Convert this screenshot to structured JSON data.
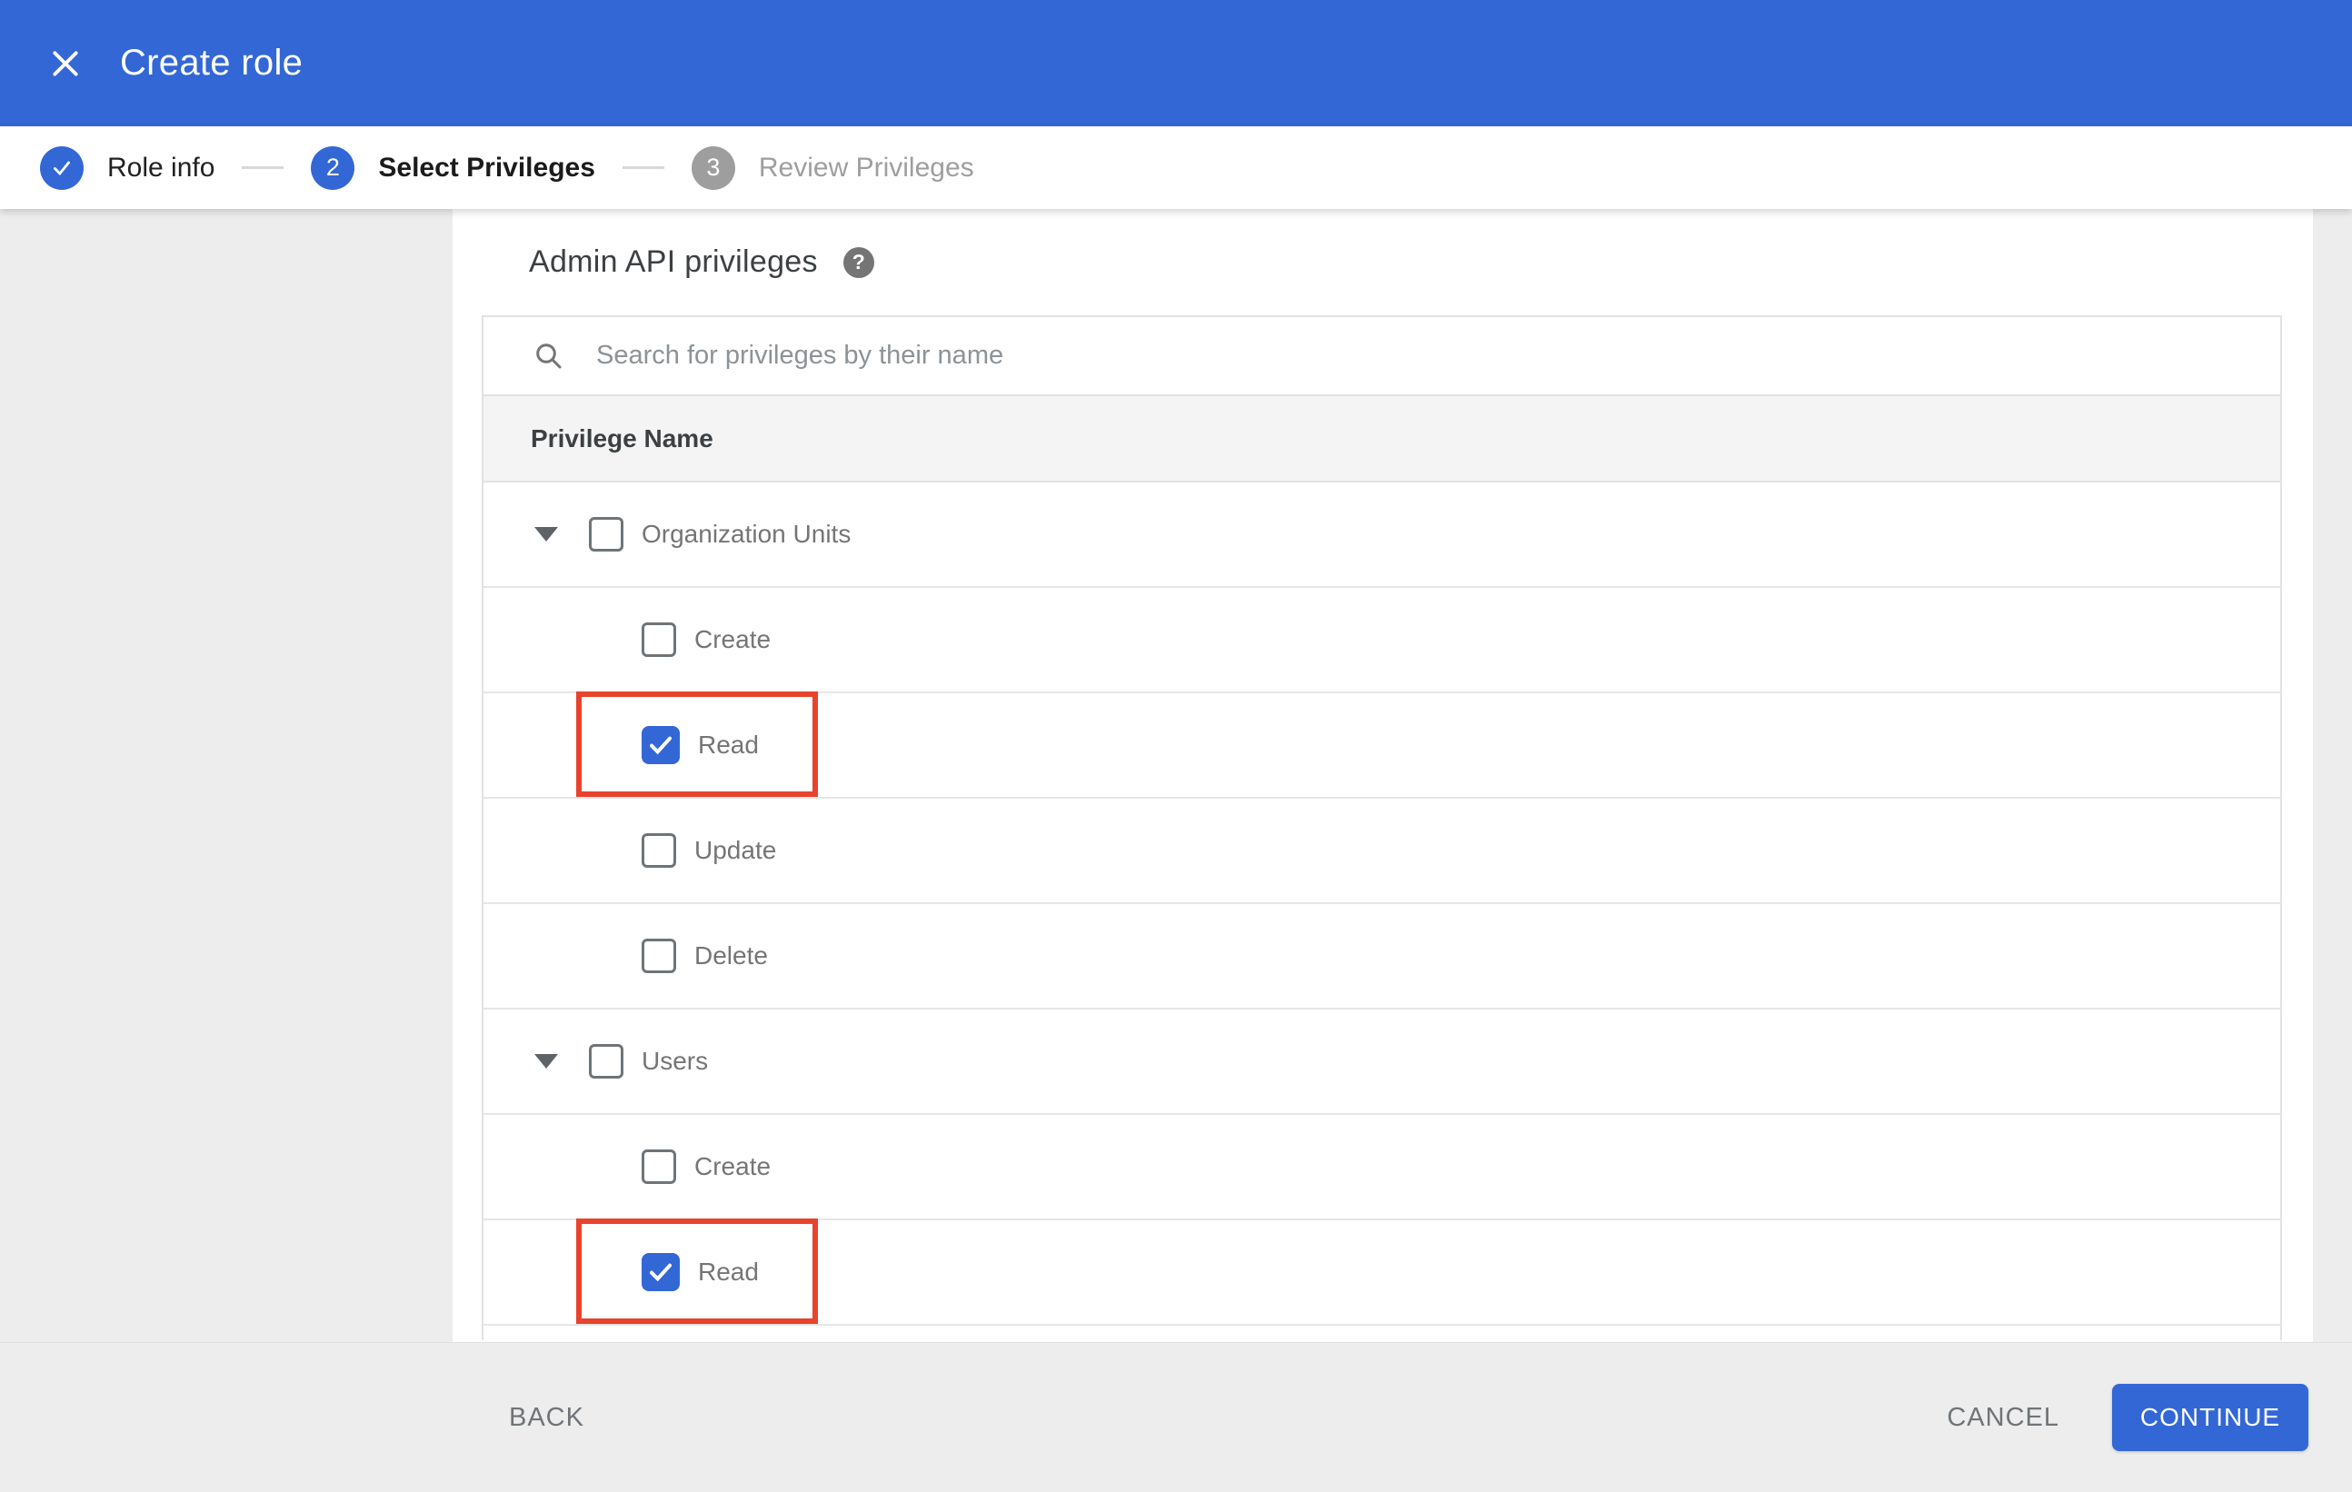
{
  "app_bar": {
    "title": "Create role",
    "close_icon": "x"
  },
  "stepper": {
    "steps": [
      {
        "label": "Role info",
        "state": "completed",
        "indicator": "check"
      },
      {
        "label": "Select Privileges",
        "state": "active",
        "indicator": "2"
      },
      {
        "label": "Review Privileges",
        "state": "upcoming",
        "indicator": "3"
      }
    ]
  },
  "content": {
    "heading": "Admin API privileges",
    "help_icon": "question-mark",
    "search": {
      "placeholder": "Search for privileges by their name",
      "value": ""
    },
    "table": {
      "header": "Privilege Name",
      "rows": [
        {
          "label": "Organization Units",
          "level": "parent",
          "expanded": true,
          "checked": false,
          "highlighted": false
        },
        {
          "label": "Create",
          "level": "child",
          "checked": false,
          "highlighted": false
        },
        {
          "label": "Read",
          "level": "child",
          "checked": true,
          "highlighted": true
        },
        {
          "label": "Update",
          "level": "child",
          "checked": false,
          "highlighted": false
        },
        {
          "label": "Delete",
          "level": "child",
          "checked": false,
          "highlighted": false
        },
        {
          "label": "Users",
          "level": "parent",
          "expanded": true,
          "checked": false,
          "highlighted": false
        },
        {
          "label": "Create",
          "level": "child",
          "checked": false,
          "highlighted": false
        },
        {
          "label": "Read",
          "level": "child",
          "checked": true,
          "highlighted": true
        }
      ]
    }
  },
  "footer": {
    "back_label": "BACK",
    "cancel_label": "CANCEL",
    "continue_label": "CONTINUE"
  },
  "colors": {
    "primary_blue": "#3367d6",
    "highlight_red": "#e8432d",
    "step_inactive_gray": "#9e9e9e"
  }
}
